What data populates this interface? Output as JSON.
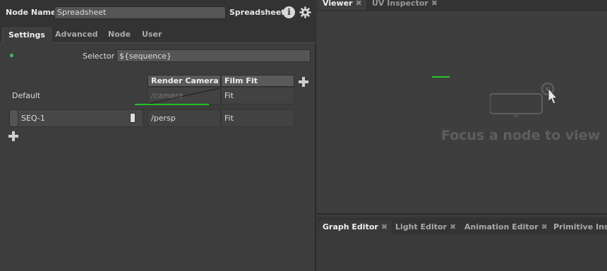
{
  "node": {
    "name_label": "Node Name",
    "name_value": "Spreadsheet",
    "type_label": "Spreadsheet",
    "info_glyph": "i"
  },
  "tabs": [
    "Settings",
    "Advanced",
    "Node",
    "User"
  ],
  "selector": {
    "label": "Selector",
    "value": "${sequence}"
  },
  "grid": {
    "columns": [
      "Render Camera",
      "Film Fit"
    ],
    "default_label": "Default",
    "default_values": [
      "/camera",
      "Fit"
    ],
    "rows": [
      {
        "name": "SEQ-1",
        "values": [
          "/persp",
          "Fit"
        ]
      }
    ]
  },
  "viewer": {
    "tabs": [
      "Viewer",
      "UV Inspector"
    ],
    "placeholder": "Focus a node to view"
  },
  "bottom": {
    "tabs": [
      "Graph Editor",
      "Light Editor",
      "Animation Editor",
      "Primitive Insp"
    ]
  },
  "colors": {
    "accent_green": "#22c322",
    "panel": "#3d3d3d"
  }
}
